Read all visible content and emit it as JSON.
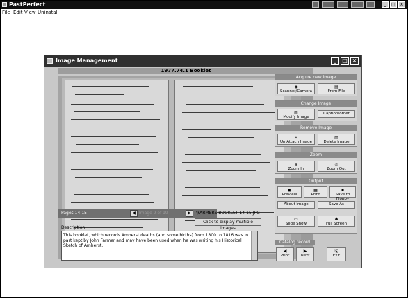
{
  "app": {
    "title": "PastPerfect"
  },
  "menu": [
    "File",
    "Edit",
    "View",
    "Uninstall"
  ],
  "dialog": {
    "title": "Image Management",
    "image_header": "1977.74.1 Booklet",
    "pages_label": "Pages 14-15",
    "image_counter": "Image 9 of 19",
    "filename": "\\FARMERS BOOKLET 14-15.JPG",
    "multi_images_button": "Click to display multiple images",
    "description_label": "Description",
    "description_text": "This booklet, which records Amherst deaths (and some births) from 1800 to 1816 was in part kept by John Farmer and may have been used when he was writing his Historical Sketch of Amherst."
  },
  "panel": {
    "acquire": {
      "title": "Acquire new image",
      "scanner": "Scanner/Camera",
      "from_file": "From File"
    },
    "change": {
      "title": "Change Image",
      "modify": "Modify Image",
      "caption": "Caption/order"
    },
    "remove": {
      "title": "Remove Image",
      "unattach": "Un Attach Image",
      "delete": "Delete Image"
    },
    "zoom": {
      "title": "Zoom",
      "zoom_in": "Zoom In",
      "zoom_out": "Zoom Out"
    },
    "output": {
      "title": "Output",
      "preview": "Preview",
      "print": "Print",
      "save_floppy": "Save to Floppy",
      "about": "About Image",
      "save_as": "Save As",
      "slide_show": "Slide Show",
      "full_screen": "Full Screen"
    },
    "catalog": {
      "title": "Catalog record",
      "prior": "Prior",
      "next": "Next",
      "exit": "Exit"
    }
  }
}
